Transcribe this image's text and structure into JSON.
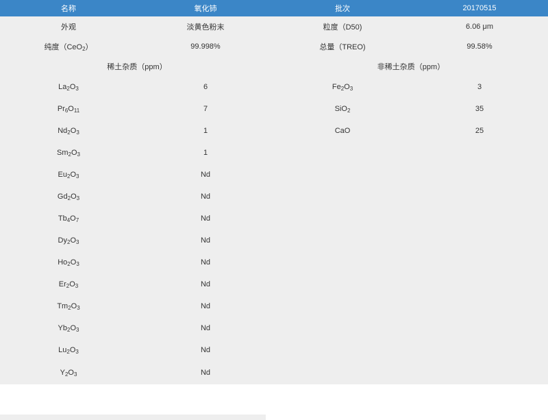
{
  "header": [
    "名称",
    "氧化铈",
    "批次",
    "20170515"
  ],
  "info_rows": [
    {
      "c1": [
        {
          "t": "外观"
        }
      ],
      "c2": "淡黄色粉末",
      "c3": [
        {
          "t": "粒度（D50)"
        }
      ],
      "c4": "6.06 μm"
    },
    {
      "c1": [
        {
          "t": "纯度（CeO"
        },
        {
          "t": "2",
          "sub": true
        },
        {
          "t": "）"
        }
      ],
      "c2": "99.998%",
      "c3": [
        {
          "t": "总量（TREO)"
        }
      ],
      "c4": "99.58%"
    }
  ],
  "sections": {
    "rare_earth": "稀土杂质（ppm）",
    "non_rare_earth": "非稀土杂质（ppm）"
  },
  "rare_earth_impurities": [
    {
      "formula": [
        {
          "t": "La"
        },
        {
          "t": "2",
          "sub": true
        },
        {
          "t": "O"
        },
        {
          "t": "3",
          "sub": true
        }
      ],
      "value": "6"
    },
    {
      "formula": [
        {
          "t": "Pr"
        },
        {
          "t": "6",
          "sub": true
        },
        {
          "t": "O"
        },
        {
          "t": "11",
          "sub": true
        }
      ],
      "value": "7"
    },
    {
      "formula": [
        {
          "t": "Nd"
        },
        {
          "t": "2",
          "sub": true
        },
        {
          "t": "O"
        },
        {
          "t": "3",
          "sub": true
        }
      ],
      "value": "1"
    },
    {
      "formula": [
        {
          "t": "Sm"
        },
        {
          "t": "2",
          "sub": true
        },
        {
          "t": "O"
        },
        {
          "t": "3",
          "sub": true
        }
      ],
      "value": "1"
    },
    {
      "formula": [
        {
          "t": "Eu"
        },
        {
          "t": "2",
          "sub": true
        },
        {
          "t": "O"
        },
        {
          "t": "3",
          "sub": true
        }
      ],
      "value": "Nd"
    },
    {
      "formula": [
        {
          "t": "Gd"
        },
        {
          "t": "2",
          "sub": true
        },
        {
          "t": "O"
        },
        {
          "t": "3",
          "sub": true
        }
      ],
      "value": "Nd"
    },
    {
      "formula": [
        {
          "t": "Tb"
        },
        {
          "t": "4",
          "sub": true
        },
        {
          "t": "O"
        },
        {
          "t": "7",
          "sub": true
        }
      ],
      "value": "Nd"
    },
    {
      "formula": [
        {
          "t": "Dy"
        },
        {
          "t": "2",
          "sub": true
        },
        {
          "t": "O"
        },
        {
          "t": "3",
          "sub": true
        }
      ],
      "value": "Nd"
    },
    {
      "formula": [
        {
          "t": "Ho"
        },
        {
          "t": "2",
          "sub": true
        },
        {
          "t": "O"
        },
        {
          "t": "3",
          "sub": true
        }
      ],
      "value": "Nd"
    },
    {
      "formula": [
        {
          "t": "Er"
        },
        {
          "t": "2",
          "sub": true
        },
        {
          "t": "O"
        },
        {
          "t": "3",
          "sub": true
        }
      ],
      "value": "Nd"
    },
    {
      "formula": [
        {
          "t": "Tm"
        },
        {
          "t": "2",
          "sub": true
        },
        {
          "t": "O"
        },
        {
          "t": "3",
          "sub": true
        }
      ],
      "value": "Nd"
    },
    {
      "formula": [
        {
          "t": "Yb"
        },
        {
          "t": "2",
          "sub": true
        },
        {
          "t": "O"
        },
        {
          "t": "3",
          "sub": true
        }
      ],
      "value": "Nd"
    },
    {
      "formula": [
        {
          "t": "Lu"
        },
        {
          "t": "2",
          "sub": true
        },
        {
          "t": "O"
        },
        {
          "t": "3",
          "sub": true
        }
      ],
      "value": "Nd"
    },
    {
      "formula": [
        {
          "t": "Y"
        },
        {
          "t": "2",
          "sub": true
        },
        {
          "t": "O"
        },
        {
          "t": "3",
          "sub": true
        }
      ],
      "value": "Nd"
    }
  ],
  "non_rare_earth_impurities": [
    {
      "formula": [
        {
          "t": "Fe"
        },
        {
          "t": "2",
          "sub": true
        },
        {
          "t": "O"
        },
        {
          "t": "3",
          "sub": true
        }
      ],
      "value": "3"
    },
    {
      "formula": [
        {
          "t": "SiO"
        },
        {
          "t": "2",
          "sub": true
        }
      ],
      "value": "35"
    },
    {
      "formula": [
        {
          "t": "CaO"
        }
      ],
      "value": "25"
    }
  ]
}
